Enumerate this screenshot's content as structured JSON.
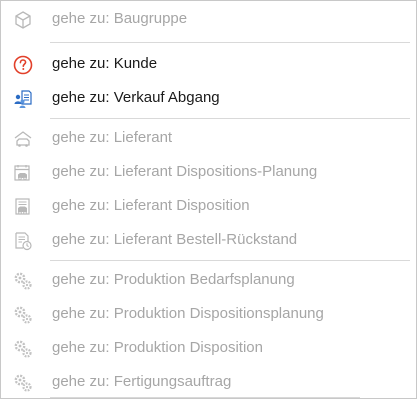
{
  "menu": {
    "items": [
      {
        "label": "gehe zu: Baugruppe",
        "icon": "cube-icon",
        "enabled": false
      },
      {
        "label": "gehe zu: Kunde",
        "icon": "question-circle-icon",
        "enabled": true
      },
      {
        "label": "gehe zu: Verkauf Abgang",
        "icon": "people-document-icon",
        "enabled": true
      },
      {
        "label": "gehe zu: Lieferant",
        "icon": "truck-house-icon",
        "enabled": false
      },
      {
        "label": "gehe zu: Lieferant Dispositions-Planung",
        "icon": "truck-calendar-icon",
        "enabled": false
      },
      {
        "label": "gehe zu: Lieferant Disposition",
        "icon": "truck-list-icon",
        "enabled": false
      },
      {
        "label": "gehe zu: Lieferant Bestell-Rückstand",
        "icon": "document-clock-icon",
        "enabled": false
      },
      {
        "label": "gehe zu: Produktion Bedarfsplanung",
        "icon": "gears-icon",
        "enabled": false
      },
      {
        "label": "gehe zu: Produktion Dispositionsplanung",
        "icon": "gears-icon",
        "enabled": false
      },
      {
        "label": "gehe zu: Produktion Disposition",
        "icon": "gears-icon",
        "enabled": false
      },
      {
        "label": "gehe zu: Fertigungsauftrag",
        "icon": "gears-icon",
        "enabled": false
      }
    ]
  },
  "colors": {
    "disabled_text": "#a6a6a6",
    "enabled_text": "#1a1a1a",
    "kunde_icon": "#e2402a",
    "verkauf_icon": "#2b6cc4",
    "disabled_icon": "#b8b8b8"
  }
}
